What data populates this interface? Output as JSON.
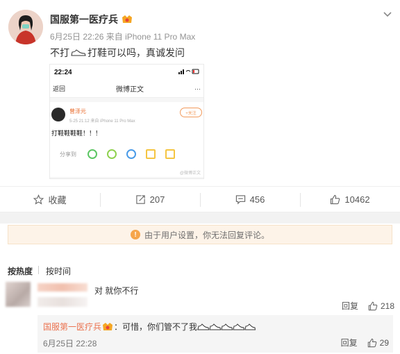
{
  "post": {
    "username": "国服第一医疗兵",
    "date": "6月25日 22:26",
    "source": "来自 iPhone 11 Pro Max",
    "text_before": "不打",
    "text_after": "打鞋可以吗，真诚发问"
  },
  "embedded_screenshot": {
    "time": "22:24",
    "back_label": "返回",
    "title": "微博正文",
    "more_label": "···",
    "author": "曾泽元",
    "meta": "5-25 21:12 来自 iPhone 11 Pro Max",
    "follow_label": "+关注",
    "text": "打鞋鞋鞋鞋！！！",
    "share_label": "分享到",
    "footer": "@微博正文"
  },
  "actions": {
    "favorite_label": "收藏",
    "repost_count": "207",
    "comment_count": "456",
    "like_count": "10462"
  },
  "notice": {
    "text": "由于用户设置，你无法回复评论。"
  },
  "sort": {
    "hot": "按热度",
    "time": "按时间"
  },
  "comment": {
    "text": "对 就你不行",
    "reply_label": "回复",
    "like_count": "218"
  },
  "reply": {
    "name": "国服第一医疗兵",
    "text": "：可惜，你们管不了我",
    "date": "6月25日 22:28",
    "reply_label": "回复",
    "like_count": "29"
  }
}
